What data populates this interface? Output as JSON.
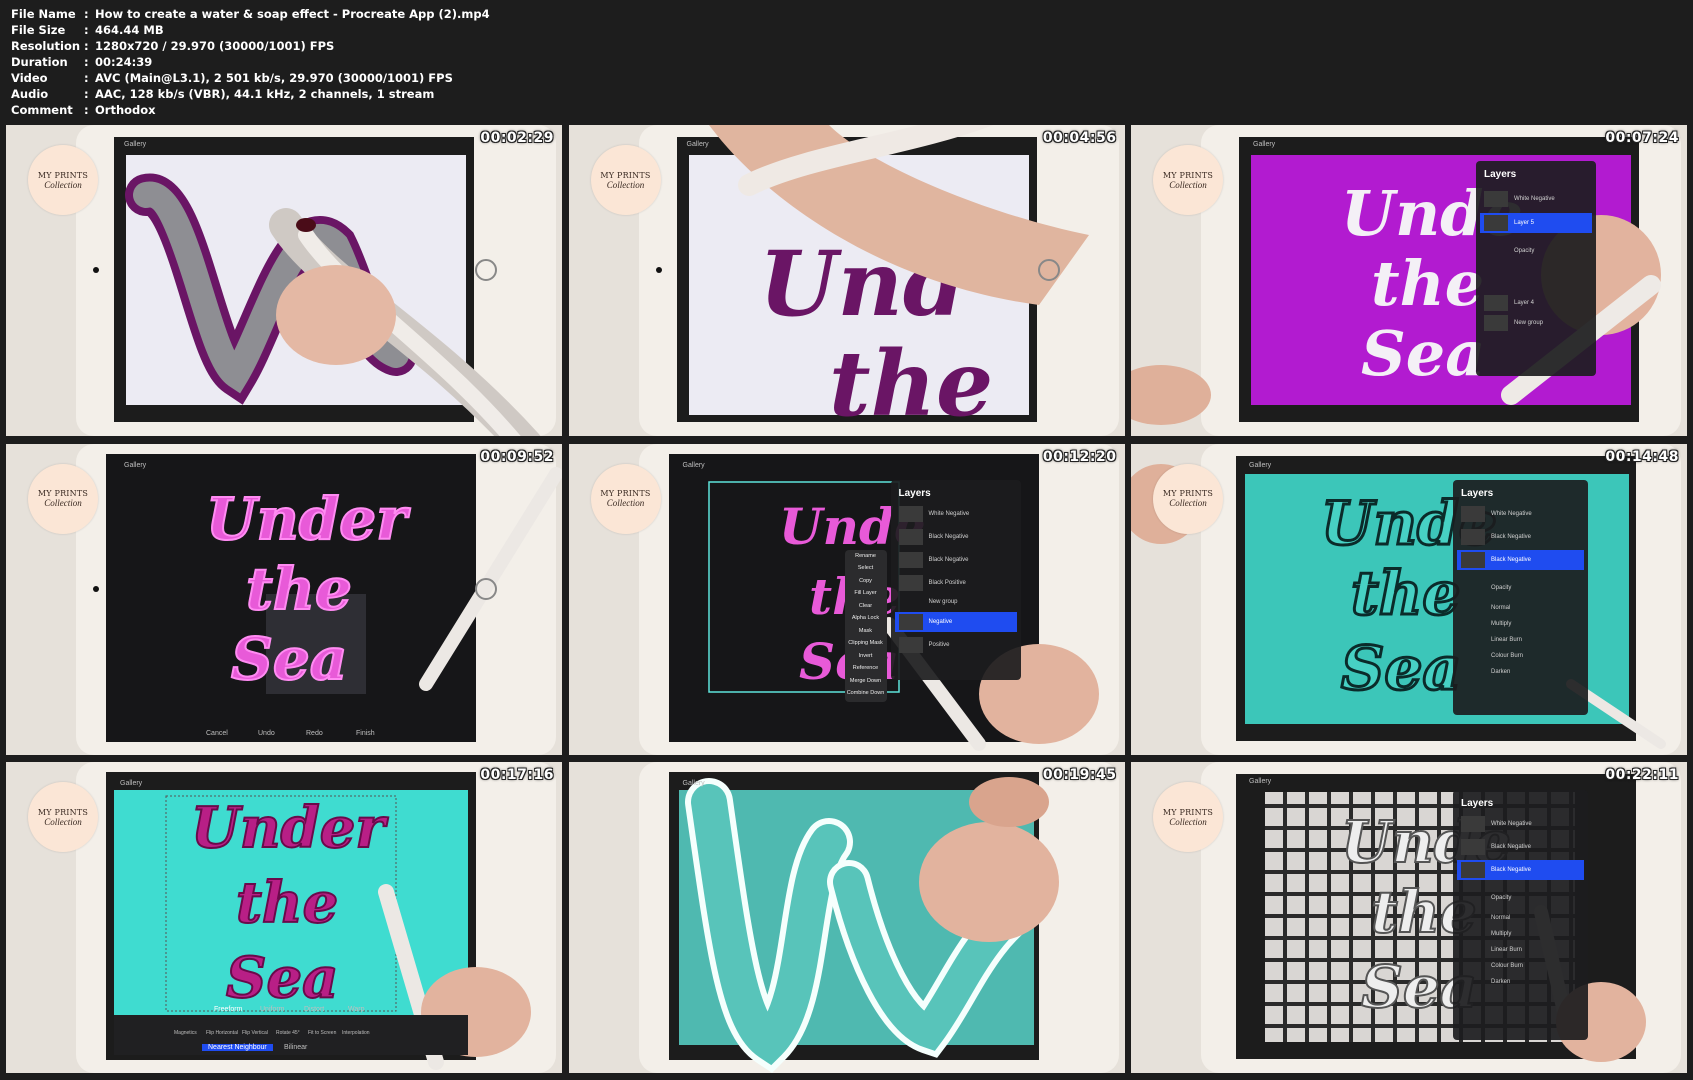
{
  "info": [
    {
      "key": "File Name",
      "value": "How to create a water & soap effect - Procreate App (2).mp4"
    },
    {
      "key": "File Size",
      "value": "464.44 MB"
    },
    {
      "key": "Resolution",
      "value": "1280x720 / 29.970 (30000/1001) FPS"
    },
    {
      "key": "Duration",
      "value": "00:24:39"
    },
    {
      "key": "Video",
      "value": "AVC (Main@L3.1), 2 501 kb/s, 29.970 (30000/1001) FPS"
    },
    {
      "key": "Audio",
      "value": "AAC, 128 kb/s (VBR), 44.1 kHz, 2 channels, 1 stream"
    },
    {
      "key": "Comment",
      "value": "Orthodox"
    }
  ],
  "separator": ":",
  "logo": {
    "line1": "MY PRINTS",
    "line2": "Collection"
  },
  "gallery_label": "Gallery",
  "thumbs": [
    {
      "time": "00:02:29"
    },
    {
      "time": "00:04:56"
    },
    {
      "time": "00:07:24"
    },
    {
      "time": "00:09:52"
    },
    {
      "time": "00:12:20"
    },
    {
      "time": "00:14:48"
    },
    {
      "time": "00:17:16"
    },
    {
      "time": "00:19:45"
    },
    {
      "time": "00:22:11"
    }
  ],
  "lettering": {
    "w1": "Under",
    "w2": "the",
    "w3": "Sea",
    "w1_cropped": "Unde",
    "w3_cropped": "Sea"
  },
  "panel3": {
    "title": "Layers",
    "rows": [
      "White Negative",
      "Layer 5",
      "Opacity",
      "Layer 4",
      "New group"
    ]
  },
  "panel5": {
    "title": "Layers",
    "rows": [
      "White Negative",
      "Black Negative",
      "Black Negative",
      "Black Positive",
      "New group",
      "Negative",
      "Positive"
    ],
    "menu": [
      "Rename",
      "Select",
      "Copy",
      "Fill Layer",
      "Clear",
      "Alpha Lock",
      "Mask",
      "Clipping Mask",
      "Invert",
      "Reference",
      "Merge Down",
      "Combine Down"
    ]
  },
  "panel6": {
    "title": "Layers",
    "rows": [
      "White Negative",
      "Black Negative",
      "Black Negative",
      "Opacity",
      "Normal",
      "Multiply",
      "Linear Burn",
      "Colour Burn",
      "Darken"
    ]
  },
  "panel9": {
    "title": "Layers",
    "rows": [
      "White Negative",
      "Black Negative",
      "Black Negative",
      "Opacity",
      "Normal",
      "Multiply",
      "Linear Burn",
      "Colour Burn",
      "Darken"
    ]
  },
  "transform7": {
    "tabs": [
      "Freeform",
      "Uniform",
      "Distort",
      "Warp"
    ],
    "tools": [
      "Magnetics",
      "Flip Horizontal",
      "Flip Vertical",
      "Rotate 45°",
      "Fit to Screen",
      "Interpolation"
    ],
    "buttons": [
      "Nearest Neighbour",
      "Bilinear"
    ]
  },
  "bottom4": [
    "Cancel",
    "Undo",
    "Redo",
    "Finish"
  ]
}
